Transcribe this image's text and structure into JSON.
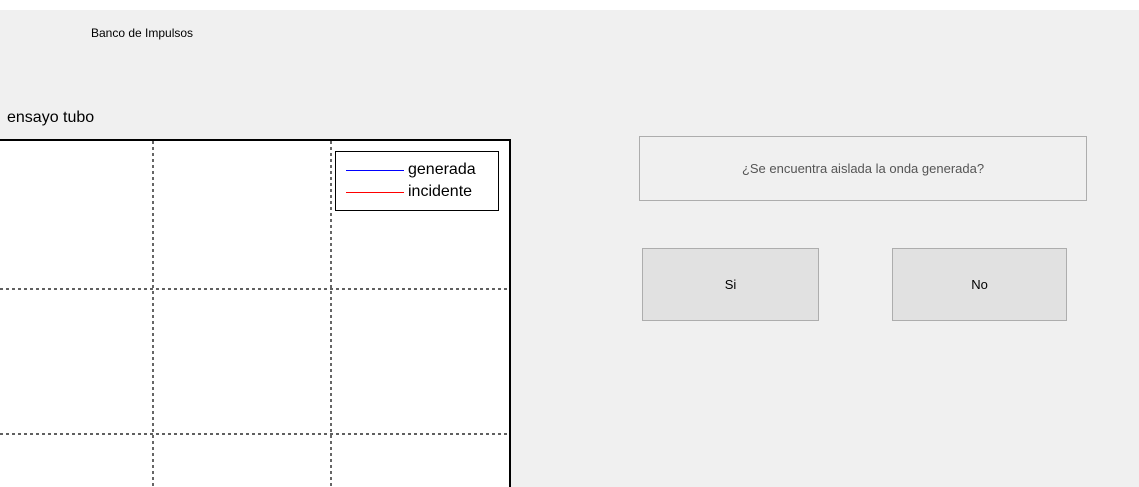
{
  "window": {
    "app_title": "Banco de Impulsos"
  },
  "plot": {
    "title": "ensayo tubo",
    "legend": [
      {
        "label": "generada",
        "color": "#0000ff"
      },
      {
        "label": "incidente",
        "color": "#ff0000"
      }
    ],
    "grid": true,
    "grid_style": "dashed"
  },
  "dialog": {
    "question": "¿Se encuentra aislada la onda generada?",
    "yes_label": "Si",
    "no_label": "No"
  }
}
